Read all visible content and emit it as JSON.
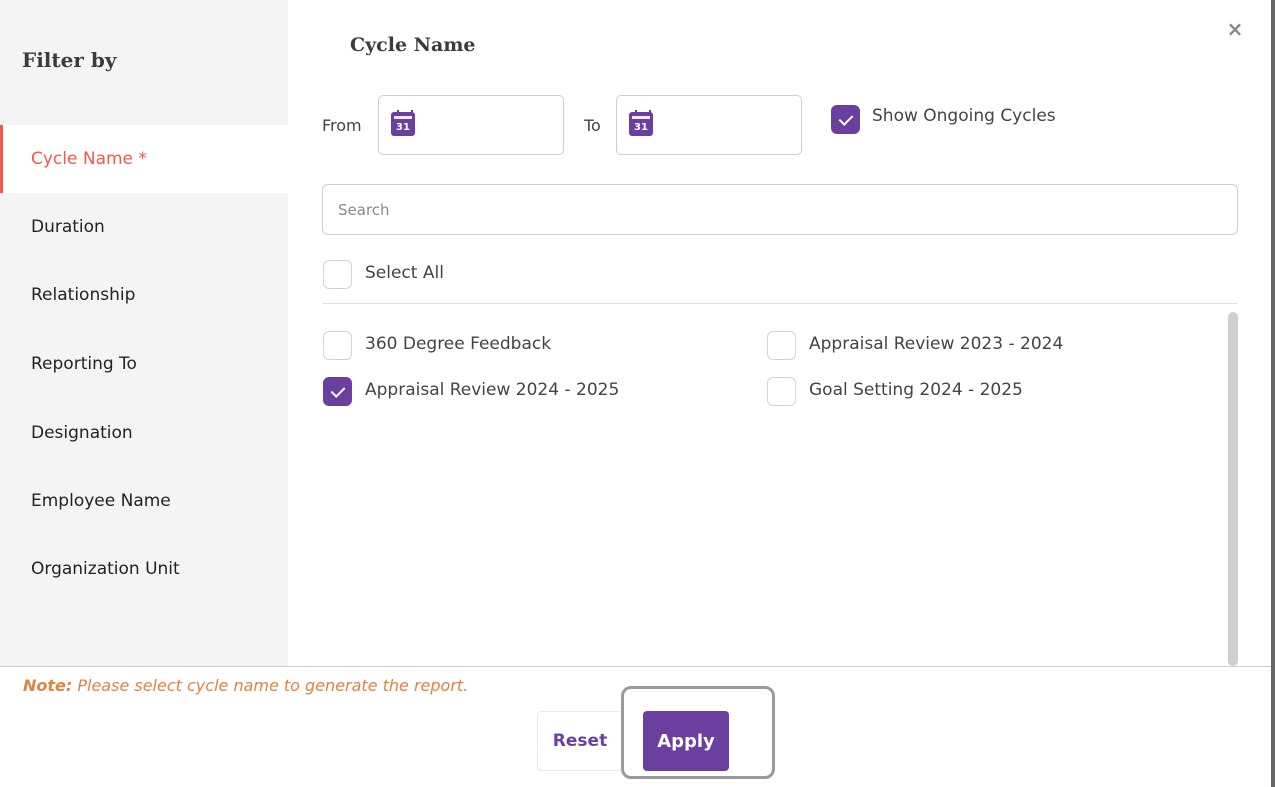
{
  "sidebar": {
    "title": "Filter by",
    "items": [
      {
        "label": "Cycle Name *"
      },
      {
        "label": "Duration"
      },
      {
        "label": "Relationship"
      },
      {
        "label": "Reporting To"
      },
      {
        "label": "Designation"
      },
      {
        "label": "Employee Name"
      },
      {
        "label": "Organization Unit"
      }
    ],
    "active_index": 0
  },
  "main": {
    "title": "Cycle Name",
    "close_icon": "×",
    "from_label": "From",
    "to_label": "To",
    "calendar_icon_day": "31",
    "show_ongoing": {
      "label": "Show Ongoing Cycles",
      "checked": true
    },
    "search": {
      "placeholder": "Search",
      "value": ""
    },
    "select_all": {
      "label": "Select All",
      "checked": false
    },
    "cycles": [
      {
        "label": "360 Degree Feedback",
        "checked": false
      },
      {
        "label": "Appraisal Review 2023 - 2024",
        "checked": false
      },
      {
        "label": "Appraisal Review 2024 - 2025",
        "checked": true
      },
      {
        "label": "Goal Setting 2024 - 2025",
        "checked": false
      }
    ]
  },
  "footer": {
    "note_prefix": "Note:",
    "note_text": " Please select cycle name to generate the report.",
    "reset_label": "Reset",
    "apply_label": "Apply"
  },
  "colors": {
    "accent": "#6b3fa0",
    "active_item": "#ef5a4f",
    "note": "#e0843e"
  }
}
